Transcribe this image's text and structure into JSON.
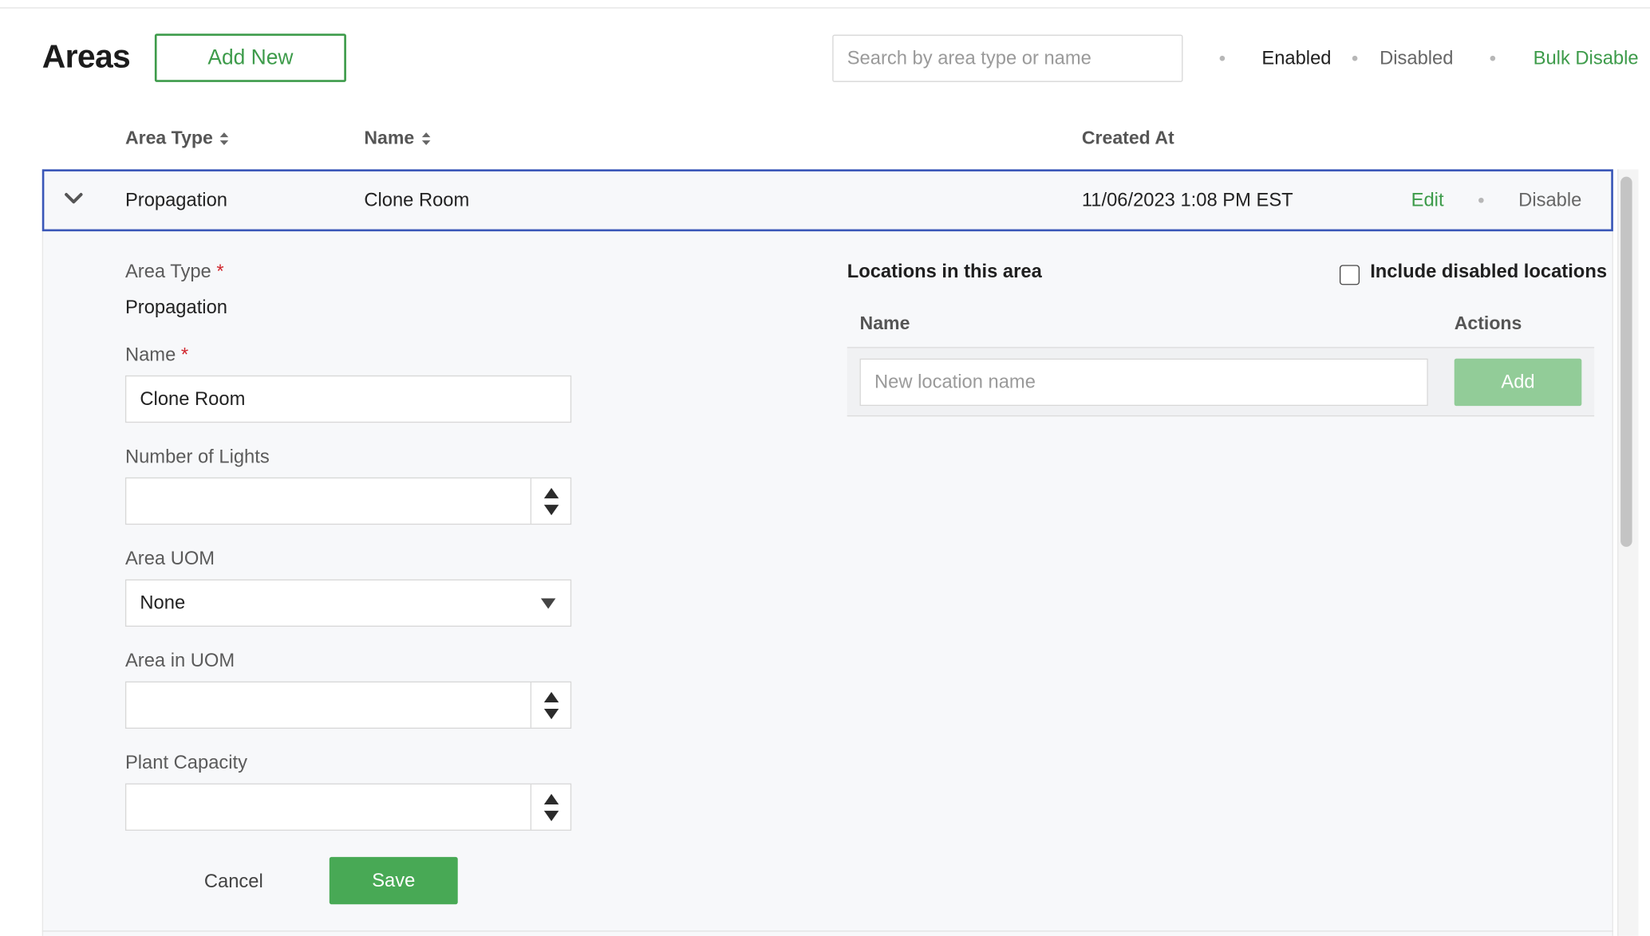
{
  "header": {
    "title": "Areas",
    "add_new_label": "Add New",
    "search_placeholder": "Search by area type or name",
    "filters": {
      "enabled": "Enabled",
      "disabled": "Disabled",
      "bulk_disable": "Bulk Disable"
    }
  },
  "table": {
    "columns": {
      "area_type": "Area Type",
      "name": "Name",
      "created_at": "Created At"
    },
    "rows": [
      {
        "area_type": "Propagation",
        "name": "Clone Room",
        "created_at": "11/06/2023 1:08 PM EST",
        "edit_label": "Edit",
        "disable_label": "Disable"
      }
    ]
  },
  "form": {
    "area_type_label": "Area Type",
    "area_type_value": "Propagation",
    "name_label": "Name",
    "name_value": "Clone Room",
    "required_mark": "*",
    "lights_label": "Number of Lights",
    "lights_value": "",
    "uom_label": "Area UOM",
    "uom_value": "None",
    "area_in_uom_label": "Area in UOM",
    "area_in_uom_value": "",
    "capacity_label": "Plant Capacity",
    "capacity_value": "",
    "cancel_label": "Cancel",
    "save_label": "Save"
  },
  "locations": {
    "title": "Locations in this area",
    "include_disabled_label": "Include disabled locations",
    "include_disabled_checked": false,
    "name_header": "Name",
    "actions_header": "Actions",
    "new_placeholder": "New location name",
    "add_label": "Add"
  },
  "colors": {
    "accent_green": "#3d9b4a",
    "save_green": "#48a955",
    "add_green_disabled": "#92cc98",
    "selected_border": "#3a57b8",
    "required_red": "#d0262d"
  }
}
